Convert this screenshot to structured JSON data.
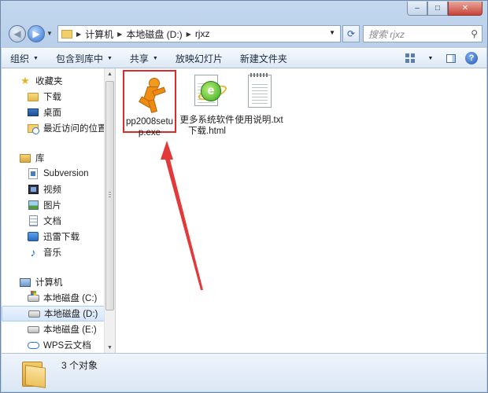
{
  "window": {
    "caption_buttons": {
      "minimize": "‒",
      "maximize": "□",
      "close": "✕"
    }
  },
  "address_bar": {
    "breadcrumbs": [
      "计算机",
      "本地磁盘 (D:)",
      "rjxz"
    ],
    "search_placeholder": "搜索 rjxz"
  },
  "toolbar": {
    "organize": "组织",
    "include_in_library": "包含到库中",
    "share": "共享",
    "slideshow": "放映幻灯片",
    "new_folder": "新建文件夹"
  },
  "nav_pane": {
    "favorites": {
      "label": "收藏夹",
      "items": [
        "下载",
        "桌面",
        "最近访问的位置"
      ]
    },
    "libraries": {
      "label": "库",
      "items": [
        "Subversion",
        "视频",
        "图片",
        "文档",
        "迅雷下载",
        "音乐"
      ]
    },
    "computer": {
      "label": "计算机",
      "items": [
        "本地磁盘 (C:)",
        "本地磁盘 (D:)",
        "本地磁盘 (E:)",
        "WPS云文档"
      ]
    },
    "selected": "本地磁盘 (D:)"
  },
  "files": [
    {
      "name": "pp2008setup.exe",
      "type": "exe",
      "highlighted": true
    },
    {
      "name": "更多系统软件下载.html",
      "type": "html",
      "highlighted": false
    },
    {
      "name": "使用说明.txt",
      "type": "txt",
      "highlighted": false
    }
  ],
  "details_pane": {
    "item_count": "3 个对象"
  },
  "colors": {
    "highlight_border": "#e02a2a",
    "arrow": "#e23a3a"
  }
}
